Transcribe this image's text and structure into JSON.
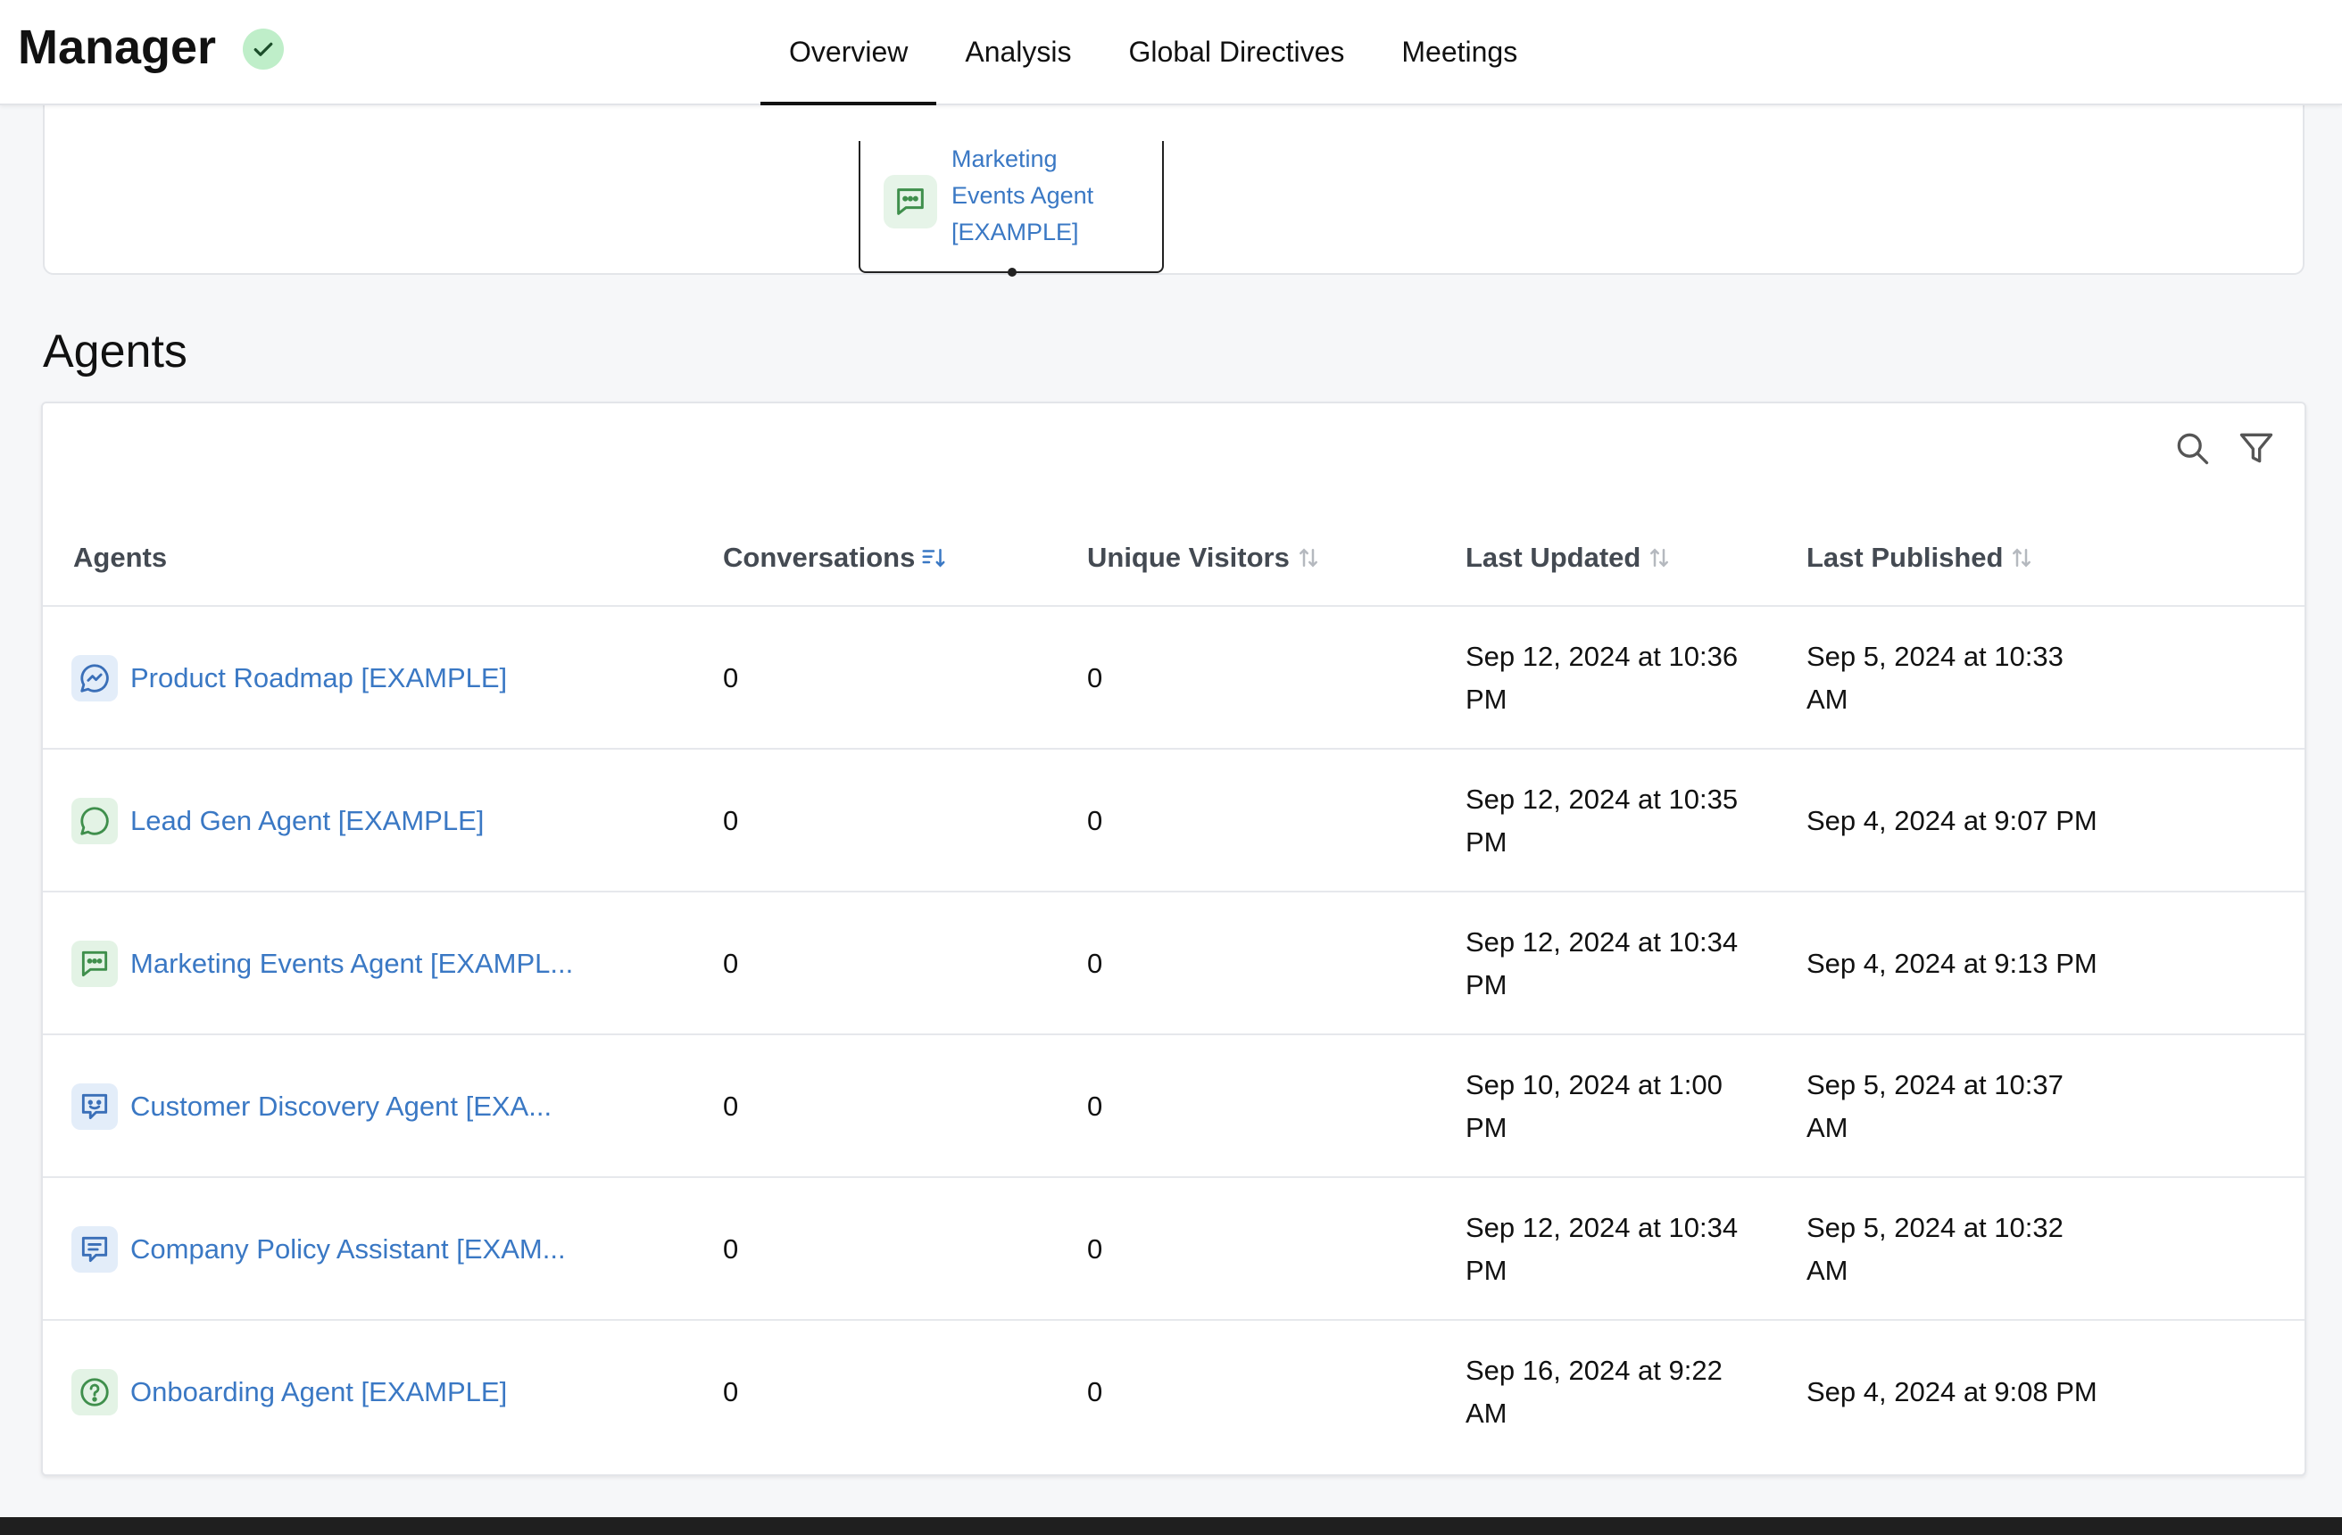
{
  "header": {
    "title": "Manager",
    "status_icon": "check-circle-icon",
    "tabs": [
      {
        "label": "Overview",
        "active": true
      },
      {
        "label": "Analysis",
        "active": false
      },
      {
        "label": "Global Directives",
        "active": false
      },
      {
        "label": "Meetings",
        "active": false
      }
    ]
  },
  "diagram": {
    "node": {
      "line1": "Marketing",
      "line2": "Events Agent",
      "line3": "[EXAMPLE]",
      "icon": "chat-dots-icon"
    }
  },
  "agents_section": {
    "title": "Agents",
    "toolbar": {
      "search_icon": "search-icon",
      "filter_icon": "filter-icon"
    },
    "columns": {
      "agents": "Agents",
      "conversations": "Conversations",
      "unique_visitors": "Unique Visitors",
      "last_updated": "Last Updated",
      "last_published": "Last Published"
    },
    "rows": [
      {
        "name": "Product Roadmap [EXAMPLE]",
        "icon": "trend-chat-icon",
        "icon_color": "blue",
        "conversations": "0",
        "unique_visitors": "0",
        "last_updated": "Sep 12, 2024 at 10:36 PM",
        "last_published": "Sep 5, 2024 at 10:33 AM"
      },
      {
        "name": "Lead Gen Agent [EXAMPLE]",
        "icon": "chat-bubble-icon",
        "icon_color": "green",
        "conversations": "0",
        "unique_visitors": "0",
        "last_updated": "Sep 12, 2024 at 10:35 PM",
        "last_published": "Sep 4, 2024 at 9:07 PM"
      },
      {
        "name": "Marketing Events Agent [EXAMPL...",
        "icon": "chat-dots-icon",
        "icon_color": "green",
        "conversations": "0",
        "unique_visitors": "0",
        "last_updated": "Sep 12, 2024 at 10:34 PM",
        "last_published": "Sep 4, 2024 at 9:13 PM"
      },
      {
        "name": "Customer Discovery Agent [EXA...",
        "icon": "smile-chat-icon",
        "icon_color": "blue",
        "conversations": "0",
        "unique_visitors": "0",
        "last_updated": "Sep 10, 2024 at 1:00 PM",
        "last_published": "Sep 5, 2024 at 10:37 AM"
      },
      {
        "name": "Company Policy Assistant [EXAM...",
        "icon": "text-chat-icon",
        "icon_color": "blue",
        "conversations": "0",
        "unique_visitors": "0",
        "last_updated": "Sep 12, 2024 at 10:34 PM",
        "last_published": "Sep 5, 2024 at 10:32 AM"
      },
      {
        "name": "Onboarding Agent [EXAMPLE]",
        "icon": "question-circle-icon",
        "icon_color": "green",
        "conversations": "0",
        "unique_visitors": "0",
        "last_updated": "Sep 16, 2024 at 9:22 AM",
        "last_published": "Sep 4, 2024 at 9:08 PM"
      }
    ]
  },
  "colors": {
    "link": "#3a78c4",
    "icon_blue": "#3a6fb8",
    "icon_green": "#3f8f4c",
    "status_bg": "#bfeec9"
  }
}
